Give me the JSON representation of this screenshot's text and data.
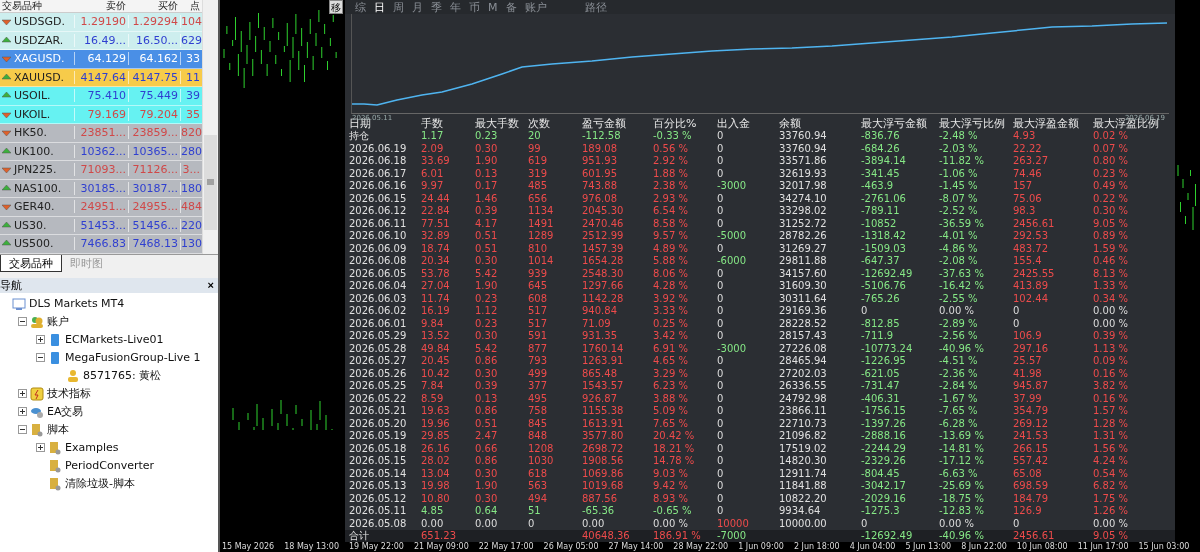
{
  "market_watch": {
    "columns": [
      "交易品种",
      "卖价",
      "买价",
      "点"
    ],
    "rows": [
      {
        "symbol": "USDSGD.",
        "bid": "1.29190",
        "ask": "1.29294",
        "spread": "104",
        "rising": false,
        "color": "#cdeeee",
        "selected": false
      },
      {
        "symbol": "USDZAR.",
        "bid": "16.49...",
        "ask": "16.50...",
        "spread": "629",
        "rising": true,
        "color": "#cdeeee",
        "selected": false
      },
      {
        "symbol": "XAGUSD.",
        "bid": "64.129",
        "ask": "64.162",
        "spread": "33",
        "rising": false,
        "color": "#4a8fe6",
        "selected": true
      },
      {
        "symbol": "XAUUSD.",
        "bid": "4147.64",
        "ask": "4147.75",
        "spread": "11",
        "rising": true,
        "color": "#f7cb4a",
        "selected": false
      },
      {
        "symbol": "USOIL.",
        "bid": "75.410",
        "ask": "75.449",
        "spread": "39",
        "rising": true,
        "color": "#66f2f2",
        "selected": false
      },
      {
        "symbol": "UKOIL.",
        "bid": "79.169",
        "ask": "79.204",
        "spread": "35",
        "rising": false,
        "color": "#66f2f2",
        "selected": false
      },
      {
        "symbol": "HK50.",
        "bid": "23851...",
        "ask": "23859...",
        "spread": "820",
        "rising": false,
        "color": "#b6b9bf",
        "selected": false
      },
      {
        "symbol": "UK100.",
        "bid": "10362...",
        "ask": "10365...",
        "spread": "280",
        "rising": true,
        "color": "#b6b9bf",
        "selected": false
      },
      {
        "symbol": "JPN225.",
        "bid": "71093...",
        "ask": "71126...",
        "spread": "3...",
        "rising": false,
        "color": "#b6b9bf",
        "selected": false
      },
      {
        "symbol": "NAS100.",
        "bid": "30185...",
        "ask": "30187...",
        "spread": "180",
        "rising": true,
        "color": "#b6b9bf",
        "selected": false
      },
      {
        "symbol": "GER40.",
        "bid": "24951...",
        "ask": "24955...",
        "spread": "484",
        "rising": false,
        "color": "#b6b9bf",
        "selected": false
      },
      {
        "symbol": "US30.",
        "bid": "51453...",
        "ask": "51456...",
        "spread": "220",
        "rising": true,
        "color": "#b6b9bf",
        "selected": false
      },
      {
        "symbol": "US500.",
        "bid": "7466.83",
        "ask": "7468.13",
        "spread": "130",
        "rising": true,
        "color": "#b6b9bf",
        "selected": false
      }
    ],
    "tabs": [
      {
        "label": "交易品种",
        "selected": true
      },
      {
        "label": "即时图",
        "selected": false
      }
    ]
  },
  "navigator": {
    "title": "导航",
    "close": "×",
    "tree": [
      {
        "label": "DLS Markets MT4",
        "kind": "terminal",
        "children": [
          {
            "label": "账户",
            "kind": "accounts",
            "expanded": true,
            "children": [
              {
                "label": "ECMarkets-Live01",
                "kind": "server",
                "expanded": false
              },
              {
                "label": "MegaFusionGroup-Live 1",
                "kind": "server",
                "expanded": true,
                "children": [
                  {
                    "label": "8571765: 黄松",
                    "kind": "user"
                  }
                ]
              }
            ]
          },
          {
            "label": "技术指标",
            "kind": "indicators",
            "expanded": false
          },
          {
            "label": "EA交易",
            "kind": "experts",
            "expanded": false
          },
          {
            "label": "脚本",
            "kind": "scripts",
            "expanded": true,
            "children": [
              {
                "label": "Examples",
                "kind": "scripts",
                "expanded": false
              },
              {
                "label": "PeriodConverter",
                "kind": "scripts"
              },
              {
                "label": "清除垃圾-脚本",
                "kind": "scripts"
              }
            ]
          }
        ]
      }
    ]
  },
  "report": {
    "move_button": "移",
    "tabs": [
      {
        "label": "综",
        "selected": false
      },
      {
        "label": "日",
        "selected": true
      },
      {
        "label": "周",
        "selected": false
      },
      {
        "label": "月",
        "selected": false
      },
      {
        "label": "季",
        "selected": false
      },
      {
        "label": "年",
        "selected": false
      },
      {
        "label": "币",
        "selected": false
      },
      {
        "label": "M",
        "selected": false
      },
      {
        "label": "备",
        "selected": false
      },
      {
        "label": "账户",
        "selected": false
      },
      {
        "label": "路径",
        "selected": false
      }
    ],
    "equity_chart": {
      "start_label": "2026.05.11",
      "end_label": "2026.06.19"
    },
    "table": {
      "columns": [
        "日期",
        "手数",
        "最大手数",
        "次数",
        "盈亏金额",
        "百分比%",
        "出入金",
        "余额",
        "最大浮亏金额",
        "最大浮亏比例",
        "最大浮盈金额",
        "最大浮盈比例"
      ],
      "rows": [
        {
          "cells": [
            "持仓",
            "1.17",
            "0.23",
            "20",
            "-112.58",
            "-0.33 %",
            "0",
            "33760.94",
            "-836.76",
            "-2.48 %",
            "4.93",
            "0.02 %"
          ],
          "kind": "loss",
          "deposit": false,
          "withdrawal": false,
          "float_loss": true,
          "float_profit": true
        },
        {
          "cells": [
            "2026.06.19",
            "2.09",
            "0.30",
            "99",
            "189.08",
            "0.56 %",
            "0",
            "33760.94",
            "-684.26",
            "-2.03 %",
            "22.22",
            "0.07 %"
          ],
          "kind": "gain",
          "deposit": false,
          "withdrawal": false,
          "float_loss": true,
          "float_profit": true
        },
        {
          "cells": [
            "2026.06.18",
            "33.69",
            "1.90",
            "619",
            "951.93",
            "2.92 %",
            "0",
            "33571.86",
            "-3894.14",
            "-11.82 %",
            "263.27",
            "0.80 %"
          ],
          "kind": "gain",
          "deposit": false,
          "withdrawal": false,
          "float_loss": true,
          "float_profit": true
        },
        {
          "cells": [
            "2026.06.17",
            "6.01",
            "0.13",
            "319",
            "601.95",
            "1.88 %",
            "0",
            "32619.93",
            "-341.45",
            "-1.06 %",
            "74.46",
            "0.23 %"
          ],
          "kind": "gain",
          "deposit": false,
          "withdrawal": false,
          "float_loss": true,
          "float_profit": true
        },
        {
          "cells": [
            "2026.06.16",
            "9.97",
            "0.17",
            "485",
            "743.88",
            "2.38 %",
            "-3000",
            "32017.98",
            "-463.9",
            "-1.45 %",
            "157",
            "0.49 %"
          ],
          "kind": "gain",
          "deposit": false,
          "withdrawal": true,
          "float_loss": true,
          "float_profit": true
        },
        {
          "cells": [
            "2026.06.15",
            "24.44",
            "1.46",
            "656",
            "976.08",
            "2.93 %",
            "0",
            "34274.10",
            "-2761.06",
            "-8.07 %",
            "75.06",
            "0.22 %"
          ],
          "kind": "gain",
          "deposit": false,
          "withdrawal": false,
          "float_loss": true,
          "float_profit": true
        },
        {
          "cells": [
            "2026.06.12",
            "22.84",
            "0.39",
            "1134",
            "2045.30",
            "6.54 %",
            "0",
            "33298.02",
            "-789.11",
            "-2.52 %",
            "98.3",
            "0.30 %"
          ],
          "kind": "gain",
          "deposit": false,
          "withdrawal": false,
          "float_loss": true,
          "float_profit": true
        },
        {
          "cells": [
            "2026.06.11",
            "77.51",
            "4.17",
            "1491",
            "2470.46",
            "8.58 %",
            "0",
            "31252.72",
            "-10852",
            "-36.59 %",
            "2456.61",
            "9.05 %"
          ],
          "kind": "gain",
          "deposit": false,
          "withdrawal": false,
          "float_loss": true,
          "float_profit": true
        },
        {
          "cells": [
            "2026.06.10",
            "32.89",
            "0.51",
            "1289",
            "2512.99",
            "9.57 %",
            "-5000",
            "28782.26",
            "-1318.42",
            "-4.01 %",
            "292.53",
            "0.89 %"
          ],
          "kind": "gain",
          "deposit": false,
          "withdrawal": true,
          "float_loss": true,
          "float_profit": true
        },
        {
          "cells": [
            "2026.06.09",
            "18.74",
            "0.51",
            "810",
            "1457.39",
            "4.89 %",
            "0",
            "31269.27",
            "-1509.03",
            "-4.86 %",
            "483.72",
            "1.59 %"
          ],
          "kind": "gain",
          "deposit": false,
          "withdrawal": false,
          "float_loss": true,
          "float_profit": true
        },
        {
          "cells": [
            "2026.06.08",
            "20.34",
            "0.30",
            "1014",
            "1654.28",
            "5.88 %",
            "-6000",
            "29811.88",
            "-647.37",
            "-2.08 %",
            "155.4",
            "0.46 %"
          ],
          "kind": "gain",
          "deposit": false,
          "withdrawal": true,
          "float_loss": true,
          "float_profit": true
        },
        {
          "cells": [
            "2026.06.05",
            "53.78",
            "5.42",
            "939",
            "2548.30",
            "8.06 %",
            "0",
            "34157.60",
            "-12692.49",
            "-37.63 %",
            "2425.55",
            "8.13 %"
          ],
          "kind": "gain",
          "deposit": false,
          "withdrawal": false,
          "float_loss": true,
          "float_profit": true
        },
        {
          "cells": [
            "2026.06.04",
            "27.04",
            "1.90",
            "645",
            "1297.66",
            "4.28 %",
            "0",
            "31609.30",
            "-5106.76",
            "-16.42 %",
            "413.89",
            "1.33 %"
          ],
          "kind": "gain",
          "deposit": false,
          "withdrawal": false,
          "float_loss": true,
          "float_profit": true
        },
        {
          "cells": [
            "2026.06.03",
            "11.74",
            "0.23",
            "608",
            "1142.28",
            "3.92 %",
            "0",
            "30311.64",
            "-765.26",
            "-2.55 %",
            "102.44",
            "0.34 %"
          ],
          "kind": "gain",
          "deposit": false,
          "withdrawal": false,
          "float_loss": true,
          "float_profit": true
        },
        {
          "cells": [
            "2026.06.02",
            "16.19",
            "1.12",
            "517",
            "940.84",
            "3.33 %",
            "0",
            "29169.36",
            "0",
            "0.00 %",
            "0",
            "0.00 %"
          ],
          "kind": "gain",
          "deposit": false,
          "withdrawal": false,
          "float_loss": false,
          "float_profit": false
        },
        {
          "cells": [
            "2026.06.01",
            "9.84",
            "0.23",
            "517",
            "71.09",
            "0.25 %",
            "0",
            "28228.52",
            "-812.85",
            "-2.89 %",
            "0",
            "0.00 %"
          ],
          "kind": "gain",
          "deposit": false,
          "withdrawal": false,
          "float_loss": true,
          "float_profit": false
        },
        {
          "cells": [
            "2026.05.29",
            "13.52",
            "0.30",
            "591",
            "931.35",
            "3.42 %",
            "0",
            "28157.43",
            "-711.9",
            "-2.56 %",
            "106.9",
            "0.39 %"
          ],
          "kind": "gain",
          "deposit": false,
          "withdrawal": false,
          "float_loss": true,
          "float_profit": true
        },
        {
          "cells": [
            "2026.05.28",
            "49.84",
            "5.42",
            "877",
            "1760.14",
            "6.91 %",
            "-3000",
            "27226.08",
            "-10773.24",
            "-40.96 %",
            "297.16",
            "1.13 %"
          ],
          "kind": "gain",
          "deposit": false,
          "withdrawal": true,
          "float_loss": true,
          "float_profit": true
        },
        {
          "cells": [
            "2026.05.27",
            "20.45",
            "0.86",
            "793",
            "1263.91",
            "4.65 %",
            "0",
            "28465.94",
            "-1226.95",
            "-4.51 %",
            "25.57",
            "0.09 %"
          ],
          "kind": "gain",
          "deposit": false,
          "withdrawal": false,
          "float_loss": true,
          "float_profit": true
        },
        {
          "cells": [
            "2026.05.26",
            "10.42",
            "0.30",
            "499",
            "865.48",
            "3.29 %",
            "0",
            "27202.03",
            "-621.05",
            "-2.36 %",
            "41.98",
            "0.16 %"
          ],
          "kind": "gain",
          "deposit": false,
          "withdrawal": false,
          "float_loss": true,
          "float_profit": true
        },
        {
          "cells": [
            "2026.05.25",
            "7.84",
            "0.39",
            "377",
            "1543.57",
            "6.23 %",
            "0",
            "26336.55",
            "-731.47",
            "-2.84 %",
            "945.87",
            "3.82 %"
          ],
          "kind": "gain",
          "deposit": false,
          "withdrawal": false,
          "float_loss": true,
          "float_profit": true
        },
        {
          "cells": [
            "2026.05.22",
            "8.59",
            "0.13",
            "495",
            "926.87",
            "3.88 %",
            "0",
            "24792.98",
            "-406.31",
            "-1.67 %",
            "37.99",
            "0.16 %"
          ],
          "kind": "gain",
          "deposit": false,
          "withdrawal": false,
          "float_loss": true,
          "float_profit": true
        },
        {
          "cells": [
            "2026.05.21",
            "19.63",
            "0.86",
            "758",
            "1155.38",
            "5.09 %",
            "0",
            "23866.11",
            "-1756.15",
            "-7.65 %",
            "354.79",
            "1.57 %"
          ],
          "kind": "gain",
          "deposit": false,
          "withdrawal": false,
          "float_loss": true,
          "float_profit": true
        },
        {
          "cells": [
            "2026.05.20",
            "19.96",
            "0.51",
            "845",
            "1613.91",
            "7.65 %",
            "0",
            "22710.73",
            "-1397.26",
            "-6.28 %",
            "269.12",
            "1.28 %"
          ],
          "kind": "gain",
          "deposit": false,
          "withdrawal": false,
          "float_loss": true,
          "float_profit": true
        },
        {
          "cells": [
            "2026.05.19",
            "29.85",
            "2.47",
            "848",
            "3577.80",
            "20.42 %",
            "0",
            "21096.82",
            "-2888.16",
            "-13.69 %",
            "241.53",
            "1.31 %"
          ],
          "kind": "gain",
          "deposit": false,
          "withdrawal": false,
          "float_loss": true,
          "float_profit": true
        },
        {
          "cells": [
            "2026.05.18",
            "26.16",
            "0.66",
            "1208",
            "2698.72",
            "18.21 %",
            "0",
            "17519.02",
            "-2244.29",
            "-14.81 %",
            "266.15",
            "1.56 %"
          ],
          "kind": "gain",
          "deposit": false,
          "withdrawal": false,
          "float_loss": true,
          "float_profit": true
        },
        {
          "cells": [
            "2026.05.15",
            "28.02",
            "0.86",
            "1030",
            "1908.56",
            "14.78 %",
            "0",
            "14820.30",
            "-2329.26",
            "-17.12 %",
            "557.42",
            "4.24 %"
          ],
          "kind": "gain",
          "deposit": false,
          "withdrawal": false,
          "float_loss": true,
          "float_profit": true
        },
        {
          "cells": [
            "2026.05.14",
            "13.04",
            "0.30",
            "618",
            "1069.86",
            "9.03 %",
            "0",
            "12911.74",
            "-804.45",
            "-6.63 %",
            "65.08",
            "0.54 %"
          ],
          "kind": "gain",
          "deposit": false,
          "withdrawal": false,
          "float_loss": true,
          "float_profit": true
        },
        {
          "cells": [
            "2026.05.13",
            "19.98",
            "1.90",
            "563",
            "1019.68",
            "9.42 %",
            "0",
            "11841.88",
            "-3042.17",
            "-25.69 %",
            "698.59",
            "6.82 %"
          ],
          "kind": "gain",
          "deposit": false,
          "withdrawal": false,
          "float_loss": true,
          "float_profit": true
        },
        {
          "cells": [
            "2026.05.12",
            "10.80",
            "0.30",
            "494",
            "887.56",
            "8.93 %",
            "0",
            "10822.20",
            "-2029.16",
            "-18.75 %",
            "184.79",
            "1.75 %"
          ],
          "kind": "gain",
          "deposit": false,
          "withdrawal": false,
          "float_loss": true,
          "float_profit": true
        },
        {
          "cells": [
            "2026.05.11",
            "4.85",
            "0.64",
            "51",
            "-65.36",
            "-0.65 %",
            "0",
            "9934.64",
            "-1275.3",
            "-12.83 %",
            "126.9",
            "1.26 %"
          ],
          "kind": "loss",
          "deposit": false,
          "withdrawal": false,
          "float_loss": true,
          "float_profit": true
        },
        {
          "cells": [
            "2026.05.08",
            "0.00",
            "0.00",
            "0",
            "0.00",
            "0.00 %",
            "10000",
            "10000.00",
            "0",
            "0.00 %",
            "0",
            "0.00 %"
          ],
          "kind": "flat",
          "deposit": true,
          "withdrawal": false,
          "float_loss": false,
          "float_profit": false
        }
      ],
      "total": {
        "cells": [
          "合计",
          "651.23",
          null,
          null,
          "40648.36",
          "186.91 %",
          "-7000",
          null,
          "-12692.49",
          "-40.96 %",
          "2456.61",
          "9.05 %"
        ],
        "kind": "gain",
        "deposit": false,
        "withdrawal": true,
        "float_loss": true,
        "float_profit": true
      }
    }
  },
  "time_axis": [
    "15 May 2026",
    "18 May 13:00",
    "19 May 22:00",
    "21 May 09:00",
    "22 May 17:00",
    "26 May 05:00",
    "27 May 14:00",
    "28 May 22:00",
    "1 Jun 09:00",
    "2 Jun 18:00",
    "4 Jun 04:00",
    "5 Jun 13:00",
    "8 Jun 22:00",
    "10 Jun 08:00",
    "11 Jun 17:00",
    "15 Jun 03:00"
  ]
}
